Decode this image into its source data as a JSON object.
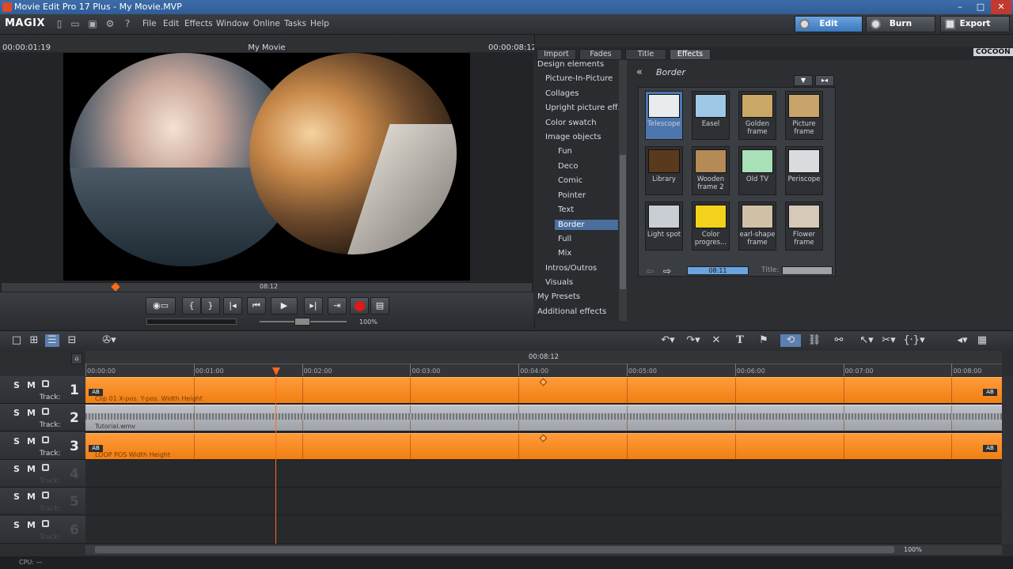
{
  "window": {
    "title": "Movie Edit Pro 17 Plus - My Movie.MVP",
    "minimize": "–",
    "maximize": "□",
    "close": "✕"
  },
  "menubar": {
    "logo": "MAGIX",
    "items": [
      "File",
      "Edit",
      "Effects",
      "Window",
      "Online",
      "Tasks",
      "Help"
    ],
    "modes": [
      "Edit",
      "Burn",
      "Export"
    ]
  },
  "preview": {
    "timecode_left": "00:00:01:19",
    "title": "My Movie",
    "timecode_right": "00:00:08:12",
    "scrub_time": "08:12",
    "zoom": "100%"
  },
  "effects": {
    "tabs": [
      "Import",
      "Fades",
      "Title",
      "Effects"
    ],
    "brand": "COCOON",
    "tree": [
      {
        "label": "Design elements",
        "level": 0
      },
      {
        "label": "Picture-In-Picture",
        "level": 1
      },
      {
        "label": "Collages",
        "level": 1
      },
      {
        "label": "Upright picture eff.",
        "level": 1
      },
      {
        "label": "Color swatch",
        "level": 1
      },
      {
        "label": "Image objects",
        "level": 1
      },
      {
        "label": "Fun",
        "level": 2
      },
      {
        "label": "Deco",
        "level": 2
      },
      {
        "label": "Comic",
        "level": 2
      },
      {
        "label": "Pointer",
        "level": 2
      },
      {
        "label": "Text",
        "level": 2
      },
      {
        "label": "Border",
        "level": 2,
        "selected": true
      },
      {
        "label": "Full",
        "level": 2
      },
      {
        "label": "Mix",
        "level": 2
      },
      {
        "label": "Intros/Outros",
        "level": 1
      },
      {
        "label": "Visuals",
        "level": 1
      },
      {
        "label": "My Presets",
        "level": 0
      },
      {
        "label": "Additional effects",
        "level": 0
      }
    ],
    "category": "Border",
    "tiles": [
      {
        "label": "Telescope",
        "color": "#e9ecef",
        "selected": true
      },
      {
        "label": "Easel",
        "color": "#9fc7e6"
      },
      {
        "label": "Golden frame",
        "color": "#c9a765"
      },
      {
        "label": "Picture frame",
        "color": "#c8a36a"
      },
      {
        "label": "Library",
        "color": "#5a3a1c"
      },
      {
        "label": "Wooden frame 2",
        "color": "#b48a56"
      },
      {
        "label": "Old TV",
        "color": "#a8e0b8"
      },
      {
        "label": "Periscope",
        "color": "#d9dcdf"
      },
      {
        "label": "Light spot",
        "color": "#c9ced4"
      },
      {
        "label": "Color progres...",
        "color": "#f2d21b"
      },
      {
        "label": "earl-shape frame",
        "color": "#cfc1a6"
      },
      {
        "label": "Flower frame",
        "color": "#d7c9b8"
      }
    ],
    "nav_time": "08:11",
    "title_label": "Title:"
  },
  "timeline": {
    "cursor_time": "00:08:12",
    "ruler": [
      "00:00:00",
      "00:01:00",
      "00:02:00",
      "00:03:00",
      "00:04:00",
      "00:05:00",
      "00:06:00",
      "00:07:00",
      "00:08:00"
    ],
    "tracks": [
      {
        "number": "1",
        "label": "Track:",
        "clip": "Clip 01   X-pos.  Y-pos.  Width  Height",
        "type": "video"
      },
      {
        "number": "2",
        "label": "Track:",
        "clip": "Tutorial.wmv",
        "type": "audio"
      },
      {
        "number": "3",
        "label": "Track:",
        "clip": "LOOP POS   Width  Height",
        "type": "video"
      },
      {
        "number": "4",
        "label": "Track:",
        "clip": "",
        "type": "empty"
      },
      {
        "number": "5",
        "label": "Track:",
        "clip": "",
        "type": "empty"
      },
      {
        "number": "6",
        "label": "Track:",
        "clip": "",
        "type": "empty"
      }
    ],
    "s_label": "S",
    "m_label": "M",
    "zoom": "100%"
  },
  "status": {
    "cpu": "CPU: —"
  },
  "colors": {
    "accent": "#3a78bd",
    "clip": "#f07f12",
    "playhead": "#ff6a1a"
  }
}
